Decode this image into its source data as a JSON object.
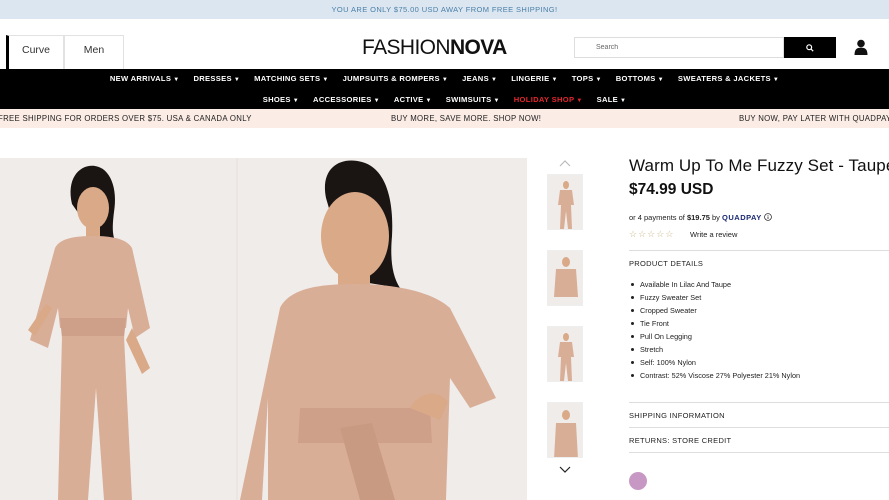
{
  "topbar": {
    "shipping_notice": "YOU ARE ONLY $75.00 USD AWAY FROM FREE SHIPPING!"
  },
  "header": {
    "tabs": [
      {
        "label": "Curve"
      },
      {
        "label": "Men"
      }
    ],
    "logo": {
      "part1": "FASHION",
      "part2": "NOVA"
    },
    "search": {
      "placeholder": "Search"
    },
    "icons": {
      "search": "search-icon",
      "account": "user-icon"
    }
  },
  "nav": {
    "row1": [
      {
        "label": "NEW ARRIVALS"
      },
      {
        "label": "DRESSES"
      },
      {
        "label": "MATCHING SETS"
      },
      {
        "label": "JUMPSUITS & ROMPERS"
      },
      {
        "label": "JEANS"
      },
      {
        "label": "LINGERIE"
      },
      {
        "label": "TOPS"
      },
      {
        "label": "BOTTOMS"
      },
      {
        "label": "SWEATERS & JACKETS"
      }
    ],
    "row2": [
      {
        "label": "SHOES"
      },
      {
        "label": "ACCESSORIES"
      },
      {
        "label": "ACTIVE"
      },
      {
        "label": "SWIMSUITS"
      },
      {
        "label": "HOLIDAY SHOP"
      },
      {
        "label": "SALE"
      }
    ],
    "highlight_color": "#e3262f"
  },
  "promo": {
    "left": "FREE SHIPPING FOR ORDERS OVER $75. USA & CANADA ONLY",
    "center": "BUY MORE, SAVE MORE. SHOP NOW!",
    "right": "BUY NOW, PAY LATER WITH QUADPAY"
  },
  "product": {
    "title": "Warm Up To Me Fuzzy Set - Taupe",
    "price": "$74.99 USD",
    "installment_prefix": "or 4 payments of",
    "installment_amount": "$19.75",
    "installment_by": "by",
    "installment_provider": "QUADPAY",
    "rating": 0,
    "write_review": "Write a review",
    "details_heading": "PRODUCT DETAILS",
    "details": [
      "Available In Lilac And Taupe",
      "Fuzzy Sweater Set",
      "Cropped Sweater",
      "Tie Front",
      "Pull On Legging",
      "Stretch",
      "Self: 100% Nylon",
      "Contrast: 52% Viscose 27% Polyester 21% Nylon"
    ],
    "shipping_heading": "SHIPPING INFORMATION",
    "returns_heading": "RETURNS: STORE CREDIT",
    "swatch_color": "#c898c4"
  },
  "colors": {
    "garment": "#d9ae97",
    "skin": "#d9a988",
    "hair": "#1a1412",
    "background": "#f0ecea"
  }
}
